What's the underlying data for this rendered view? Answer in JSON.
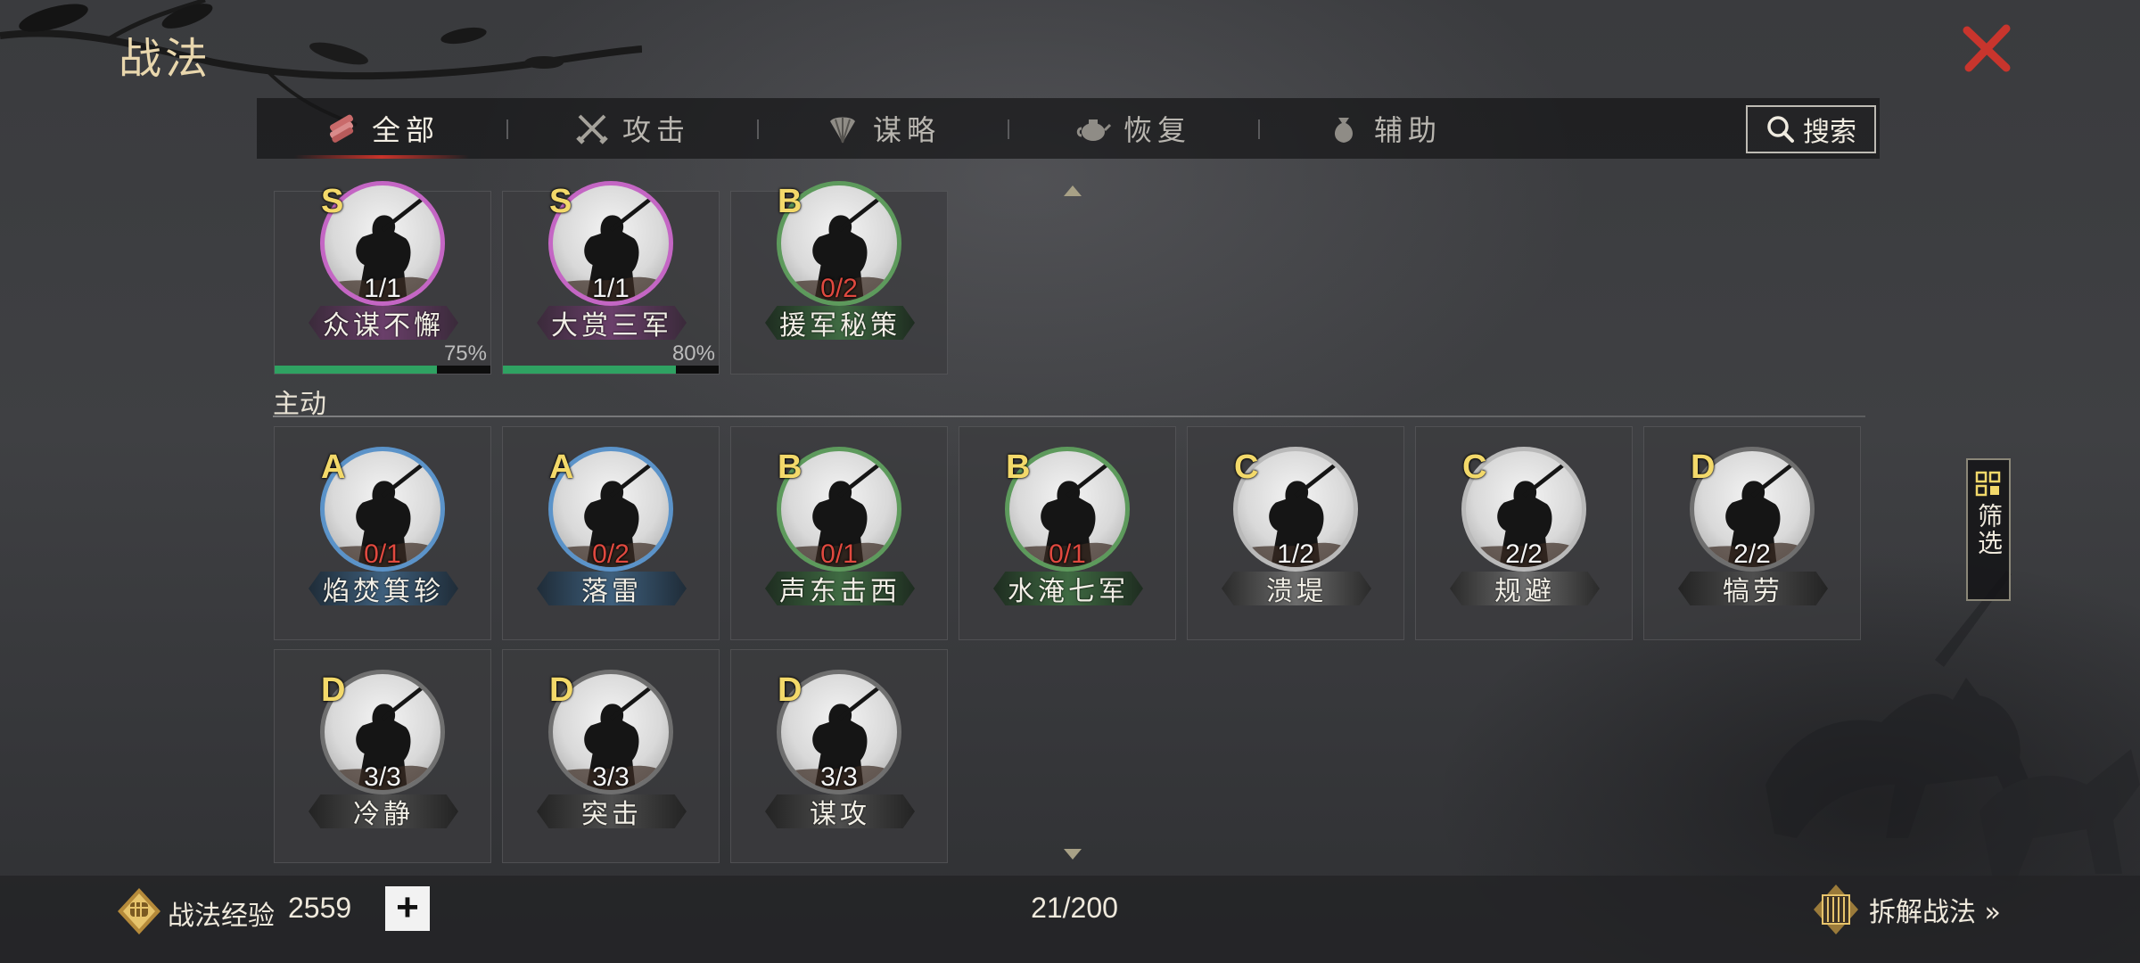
{
  "header": {
    "title": "战法"
  },
  "tabs": [
    {
      "label": "全部",
      "icon": "scroll-bundle-icon",
      "active": true
    },
    {
      "label": "攻击",
      "icon": "crossed-swords-icon",
      "active": false
    },
    {
      "label": "谋略",
      "icon": "feather-fan-icon",
      "active": false
    },
    {
      "label": "恢复",
      "icon": "teapot-icon",
      "active": false
    },
    {
      "label": "辅助",
      "icon": "pouch-icon",
      "active": false
    }
  ],
  "search": {
    "label": "搜索"
  },
  "top_row": [
    {
      "grade": "S",
      "count": "1/1",
      "count_full": true,
      "name": "众谋不懈",
      "progress": 0.75,
      "progress_text": "75%"
    },
    {
      "grade": "S",
      "count": "1/1",
      "count_full": true,
      "name": "大赏三军",
      "progress": 0.8,
      "progress_text": "80%"
    },
    {
      "grade": "B",
      "count": "0/2",
      "count_full": false,
      "name": "援军秘策"
    }
  ],
  "section": {
    "label": "主动"
  },
  "active_skills": [
    {
      "grade": "A",
      "count": "0/1",
      "count_full": false,
      "name": "焰焚箕轸"
    },
    {
      "grade": "A",
      "count": "0/2",
      "count_full": false,
      "name": "落雷"
    },
    {
      "grade": "B",
      "count": "0/1",
      "count_full": false,
      "name": "声东击西"
    },
    {
      "grade": "B",
      "count": "0/1",
      "count_full": false,
      "name": "水淹七军"
    },
    {
      "grade": "C",
      "count": "1/2",
      "count_full": true,
      "name": "溃堤"
    },
    {
      "grade": "C",
      "count": "2/2",
      "count_full": true,
      "name": "规避"
    },
    {
      "grade": "D",
      "count": "2/2",
      "count_full": true,
      "name": "犒劳"
    },
    {
      "grade": "D",
      "count": "3/3",
      "count_full": true,
      "name": "冷静"
    },
    {
      "grade": "D",
      "count": "3/3",
      "count_full": true,
      "name": "突击"
    },
    {
      "grade": "D",
      "count": "3/3",
      "count_full": true,
      "name": "谋攻"
    }
  ],
  "filter": {
    "label": "筛选"
  },
  "footer": {
    "exp_label": "战法经验",
    "exp_value": "2559",
    "plus": "+",
    "capacity": "21/200",
    "disassemble_label": "拆解战法 »"
  },
  "colors": {
    "accent_red": "#c9332a",
    "grade_text": "#f3d96a",
    "progress_green": "#2fa262",
    "count_red": "#e0493f"
  }
}
